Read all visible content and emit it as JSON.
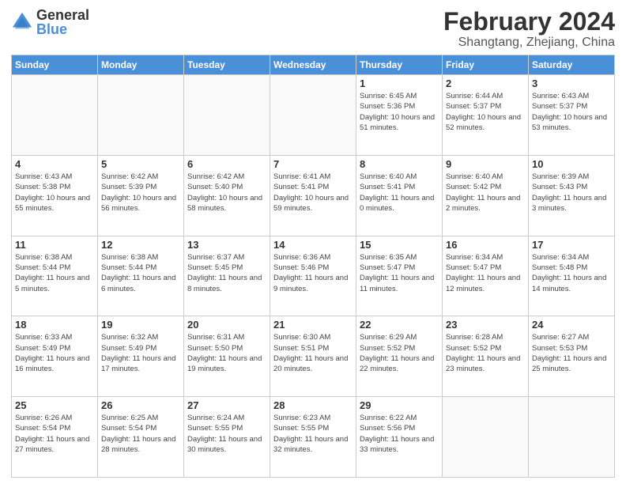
{
  "logo": {
    "general": "General",
    "blue": "Blue"
  },
  "header": {
    "month": "February 2024",
    "location": "Shangtang, Zhejiang, China"
  },
  "weekdays": [
    "Sunday",
    "Monday",
    "Tuesday",
    "Wednesday",
    "Thursday",
    "Friday",
    "Saturday"
  ],
  "weeks": [
    [
      {
        "day": "",
        "info": ""
      },
      {
        "day": "",
        "info": ""
      },
      {
        "day": "",
        "info": ""
      },
      {
        "day": "",
        "info": ""
      },
      {
        "day": "1",
        "info": "Sunrise: 6:45 AM\nSunset: 5:36 PM\nDaylight: 10 hours\nand 51 minutes."
      },
      {
        "day": "2",
        "info": "Sunrise: 6:44 AM\nSunset: 5:37 PM\nDaylight: 10 hours\nand 52 minutes."
      },
      {
        "day": "3",
        "info": "Sunrise: 6:43 AM\nSunset: 5:37 PM\nDaylight: 10 hours\nand 53 minutes."
      }
    ],
    [
      {
        "day": "4",
        "info": "Sunrise: 6:43 AM\nSunset: 5:38 PM\nDaylight: 10 hours\nand 55 minutes."
      },
      {
        "day": "5",
        "info": "Sunrise: 6:42 AM\nSunset: 5:39 PM\nDaylight: 10 hours\nand 56 minutes."
      },
      {
        "day": "6",
        "info": "Sunrise: 6:42 AM\nSunset: 5:40 PM\nDaylight: 10 hours\nand 58 minutes."
      },
      {
        "day": "7",
        "info": "Sunrise: 6:41 AM\nSunset: 5:41 PM\nDaylight: 10 hours\nand 59 minutes."
      },
      {
        "day": "8",
        "info": "Sunrise: 6:40 AM\nSunset: 5:41 PM\nDaylight: 11 hours\nand 0 minutes."
      },
      {
        "day": "9",
        "info": "Sunrise: 6:40 AM\nSunset: 5:42 PM\nDaylight: 11 hours\nand 2 minutes."
      },
      {
        "day": "10",
        "info": "Sunrise: 6:39 AM\nSunset: 5:43 PM\nDaylight: 11 hours\nand 3 minutes."
      }
    ],
    [
      {
        "day": "11",
        "info": "Sunrise: 6:38 AM\nSunset: 5:44 PM\nDaylight: 11 hours\nand 5 minutes."
      },
      {
        "day": "12",
        "info": "Sunrise: 6:38 AM\nSunset: 5:44 PM\nDaylight: 11 hours\nand 6 minutes."
      },
      {
        "day": "13",
        "info": "Sunrise: 6:37 AM\nSunset: 5:45 PM\nDaylight: 11 hours\nand 8 minutes."
      },
      {
        "day": "14",
        "info": "Sunrise: 6:36 AM\nSunset: 5:46 PM\nDaylight: 11 hours\nand 9 minutes."
      },
      {
        "day": "15",
        "info": "Sunrise: 6:35 AM\nSunset: 5:47 PM\nDaylight: 11 hours\nand 11 minutes."
      },
      {
        "day": "16",
        "info": "Sunrise: 6:34 AM\nSunset: 5:47 PM\nDaylight: 11 hours\nand 12 minutes."
      },
      {
        "day": "17",
        "info": "Sunrise: 6:34 AM\nSunset: 5:48 PM\nDaylight: 11 hours\nand 14 minutes."
      }
    ],
    [
      {
        "day": "18",
        "info": "Sunrise: 6:33 AM\nSunset: 5:49 PM\nDaylight: 11 hours\nand 16 minutes."
      },
      {
        "day": "19",
        "info": "Sunrise: 6:32 AM\nSunset: 5:49 PM\nDaylight: 11 hours\nand 17 minutes."
      },
      {
        "day": "20",
        "info": "Sunrise: 6:31 AM\nSunset: 5:50 PM\nDaylight: 11 hours\nand 19 minutes."
      },
      {
        "day": "21",
        "info": "Sunrise: 6:30 AM\nSunset: 5:51 PM\nDaylight: 11 hours\nand 20 minutes."
      },
      {
        "day": "22",
        "info": "Sunrise: 6:29 AM\nSunset: 5:52 PM\nDaylight: 11 hours\nand 22 minutes."
      },
      {
        "day": "23",
        "info": "Sunrise: 6:28 AM\nSunset: 5:52 PM\nDaylight: 11 hours\nand 23 minutes."
      },
      {
        "day": "24",
        "info": "Sunrise: 6:27 AM\nSunset: 5:53 PM\nDaylight: 11 hours\nand 25 minutes."
      }
    ],
    [
      {
        "day": "25",
        "info": "Sunrise: 6:26 AM\nSunset: 5:54 PM\nDaylight: 11 hours\nand 27 minutes."
      },
      {
        "day": "26",
        "info": "Sunrise: 6:25 AM\nSunset: 5:54 PM\nDaylight: 11 hours\nand 28 minutes."
      },
      {
        "day": "27",
        "info": "Sunrise: 6:24 AM\nSunset: 5:55 PM\nDaylight: 11 hours\nand 30 minutes."
      },
      {
        "day": "28",
        "info": "Sunrise: 6:23 AM\nSunset: 5:55 PM\nDaylight: 11 hours\nand 32 minutes."
      },
      {
        "day": "29",
        "info": "Sunrise: 6:22 AM\nSunset: 5:56 PM\nDaylight: 11 hours\nand 33 minutes."
      },
      {
        "day": "",
        "info": ""
      },
      {
        "day": "",
        "info": ""
      }
    ]
  ]
}
